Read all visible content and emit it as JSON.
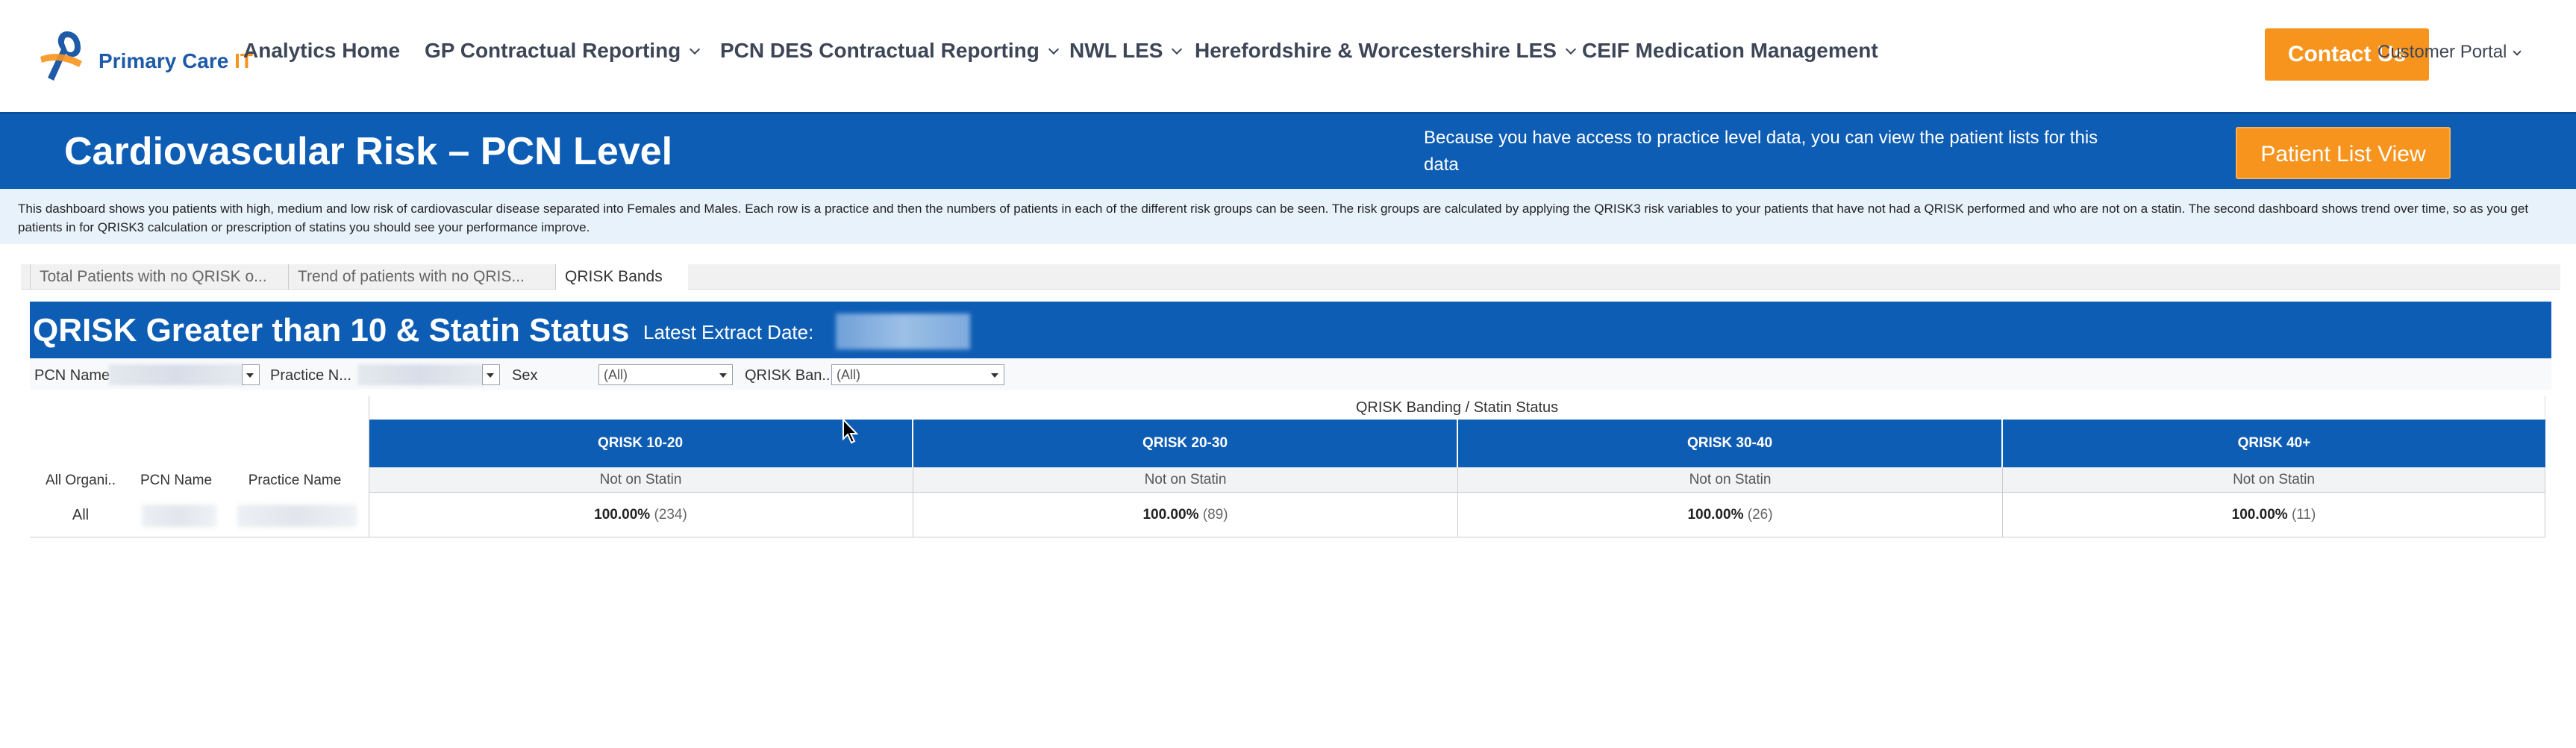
{
  "nav": {
    "logo_text_1": "Primary Care",
    "logo_text_2": "IT",
    "items": [
      {
        "label": "Analytics Home",
        "has_dropdown": false
      },
      {
        "label": "GP Contractual Reporting",
        "has_dropdown": true
      },
      {
        "label": "PCN DES Contractual Reporting",
        "has_dropdown": true
      },
      {
        "label": "NWL LES",
        "has_dropdown": true
      },
      {
        "label": "Herefordshire & Worcestershire LES",
        "has_dropdown": true
      },
      {
        "label": "CEIF Medication Management",
        "has_dropdown": false
      }
    ],
    "contact_label": "Contact Us",
    "portal_label": "Customer Portal"
  },
  "banner": {
    "title": "Cardiovascular Risk – PCN Level",
    "note": "Because you have access to practice level data, you can view the patient lists for this data",
    "button_label": "Patient List View"
  },
  "description": "This dashboard shows you patients with high, medium and low risk of cardiovascular disease separated into Females and Males.  Each row is a practice and then the numbers of patients in each of the different risk groups can be seen.  The risk groups are calculated by applying the QRISK3 risk variables to your patients that have not had a QRISK performed and who are not on a statin.  The second dashboard shows trend over time, so as you get patients in for QRISK3 calculation or prescription of statins you should see your performance improve.",
  "tabs": [
    {
      "label": "Total Patients with no QRISK o...",
      "active": false
    },
    {
      "label": "Trend of patients with no QRIS...",
      "active": false
    },
    {
      "label": "QRISK Bands",
      "active": true
    }
  ],
  "dashboard": {
    "title": "QRISK Greater than 10 & Statin Status",
    "extract_label": "Latest Extract Date:"
  },
  "filters": {
    "pcn_label": "PCN Name",
    "practice_label": "Practice N...",
    "sex_label": "Sex",
    "sex_value": "(All)",
    "band_label": "QRISK Ban...",
    "band_value": "(All)"
  },
  "table": {
    "group_header": "QRISK Banding / Statin Status",
    "row_headers": [
      "All Organi..",
      "PCN Name",
      "Practice Name"
    ],
    "row_label": "All",
    "bands": [
      {
        "label": "QRISK 10-20",
        "status": "Not on Statin",
        "pct": "100.00%",
        "count": "(234)"
      },
      {
        "label": "QRISK 20-30",
        "status": "Not on Statin",
        "pct": "100.00%",
        "count": "(89)"
      },
      {
        "label": "QRISK 30-40",
        "status": "Not on Statin",
        "pct": "100.00%",
        "count": "(26)"
      },
      {
        "label": "QRISK 40+",
        "status": "Not on Statin",
        "pct": "100.00%",
        "count": "(11)"
      }
    ]
  },
  "colors": {
    "brand_blue": "#0e5db5",
    "accent_orange": "#f7941d"
  }
}
